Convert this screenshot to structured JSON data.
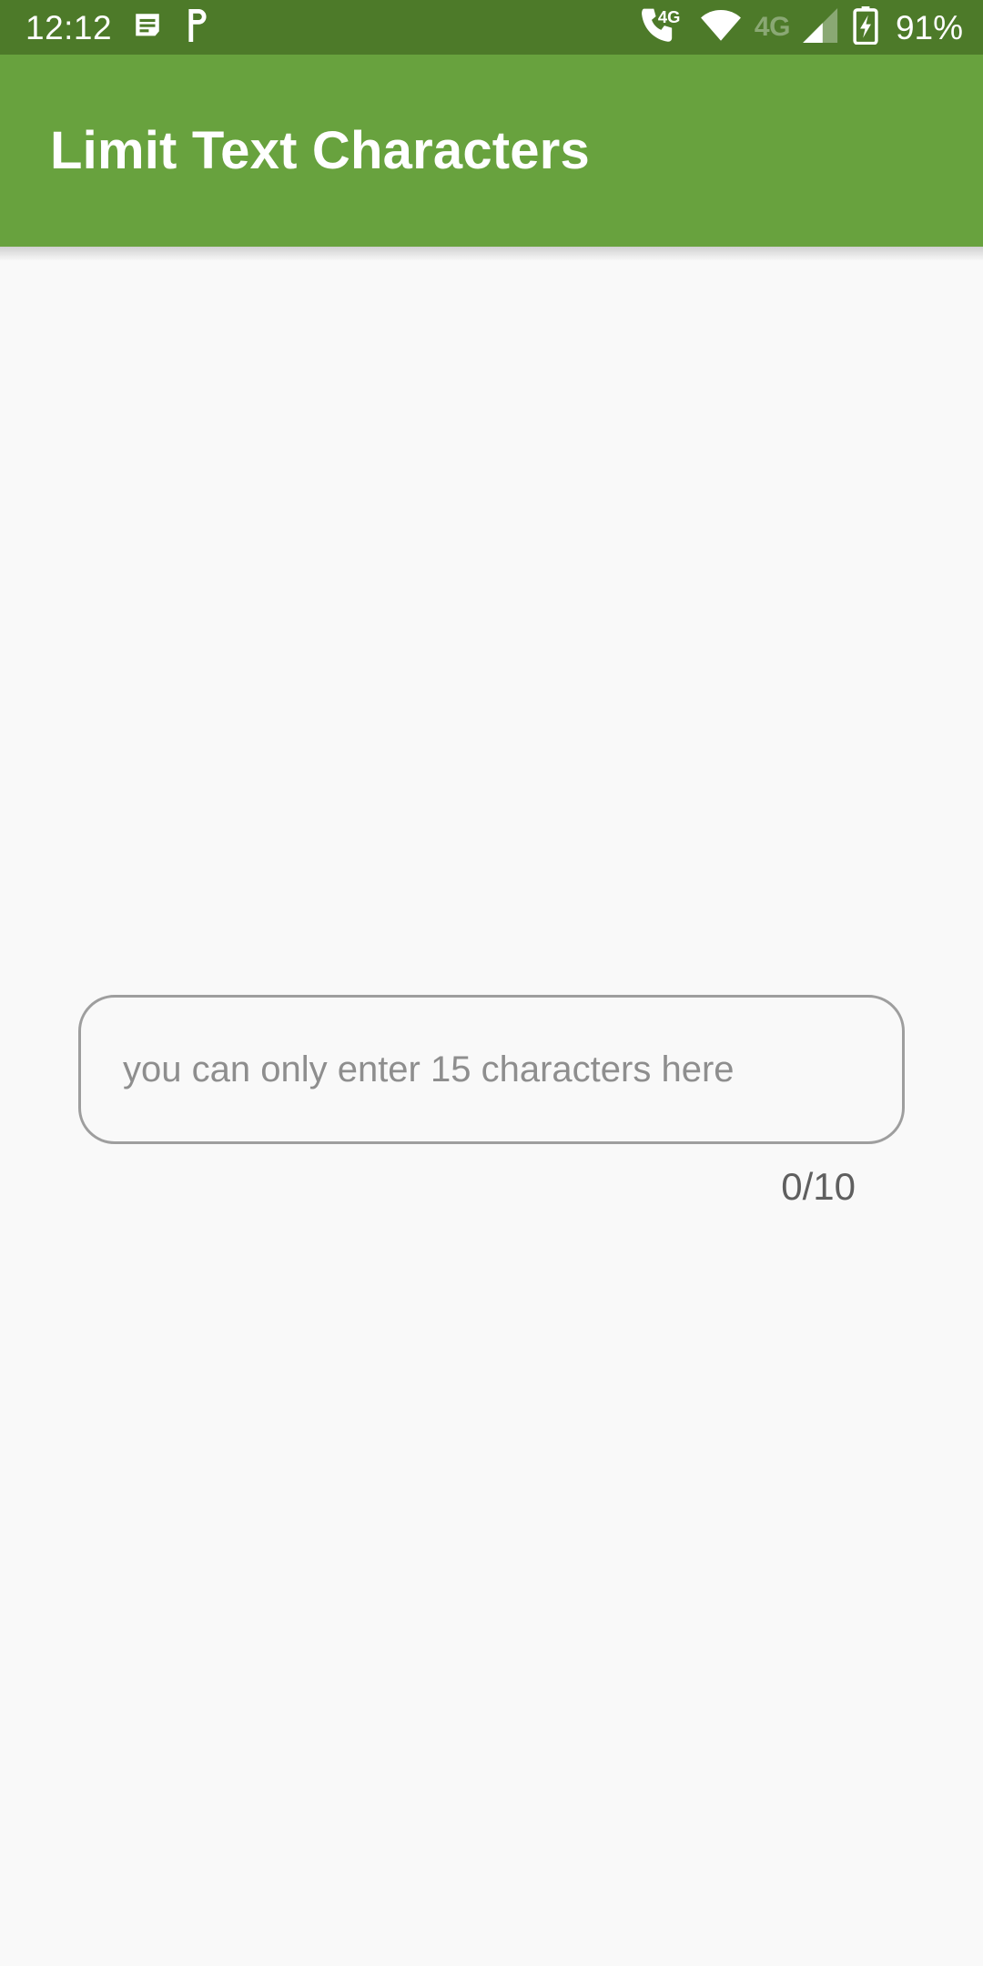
{
  "status_bar": {
    "clock": "12:12",
    "background_color": "#4d7a29",
    "foreground_color": "#ffffff",
    "left_icons": [
      {
        "name": "message-subject-icon",
        "label": ""
      },
      {
        "name": "parking-p-icon",
        "label": ""
      }
    ],
    "right_icons": [
      {
        "name": "volte-call-4g-icon",
        "label": "4G"
      },
      {
        "name": "wifi-icon",
        "label": ""
      },
      {
        "name": "mobile-network-type-label",
        "label": "4G"
      },
      {
        "name": "cellular-signal-icon",
        "label": ""
      },
      {
        "name": "battery-charging-icon",
        "label": ""
      }
    ],
    "battery_percent": "91%"
  },
  "app_bar": {
    "title": "Limit Text Characters",
    "background_color": "#68a23e",
    "title_color": "#ffffff"
  },
  "main": {
    "background_color": "#f9f9f9",
    "text_field": {
      "value": "",
      "placeholder": "you can only enter 15 characters here",
      "border_color": "#9e9e9e",
      "placeholder_color": "#8e8e8e"
    },
    "counter": {
      "text": "0/10",
      "color": "#5f5f5f"
    }
  }
}
